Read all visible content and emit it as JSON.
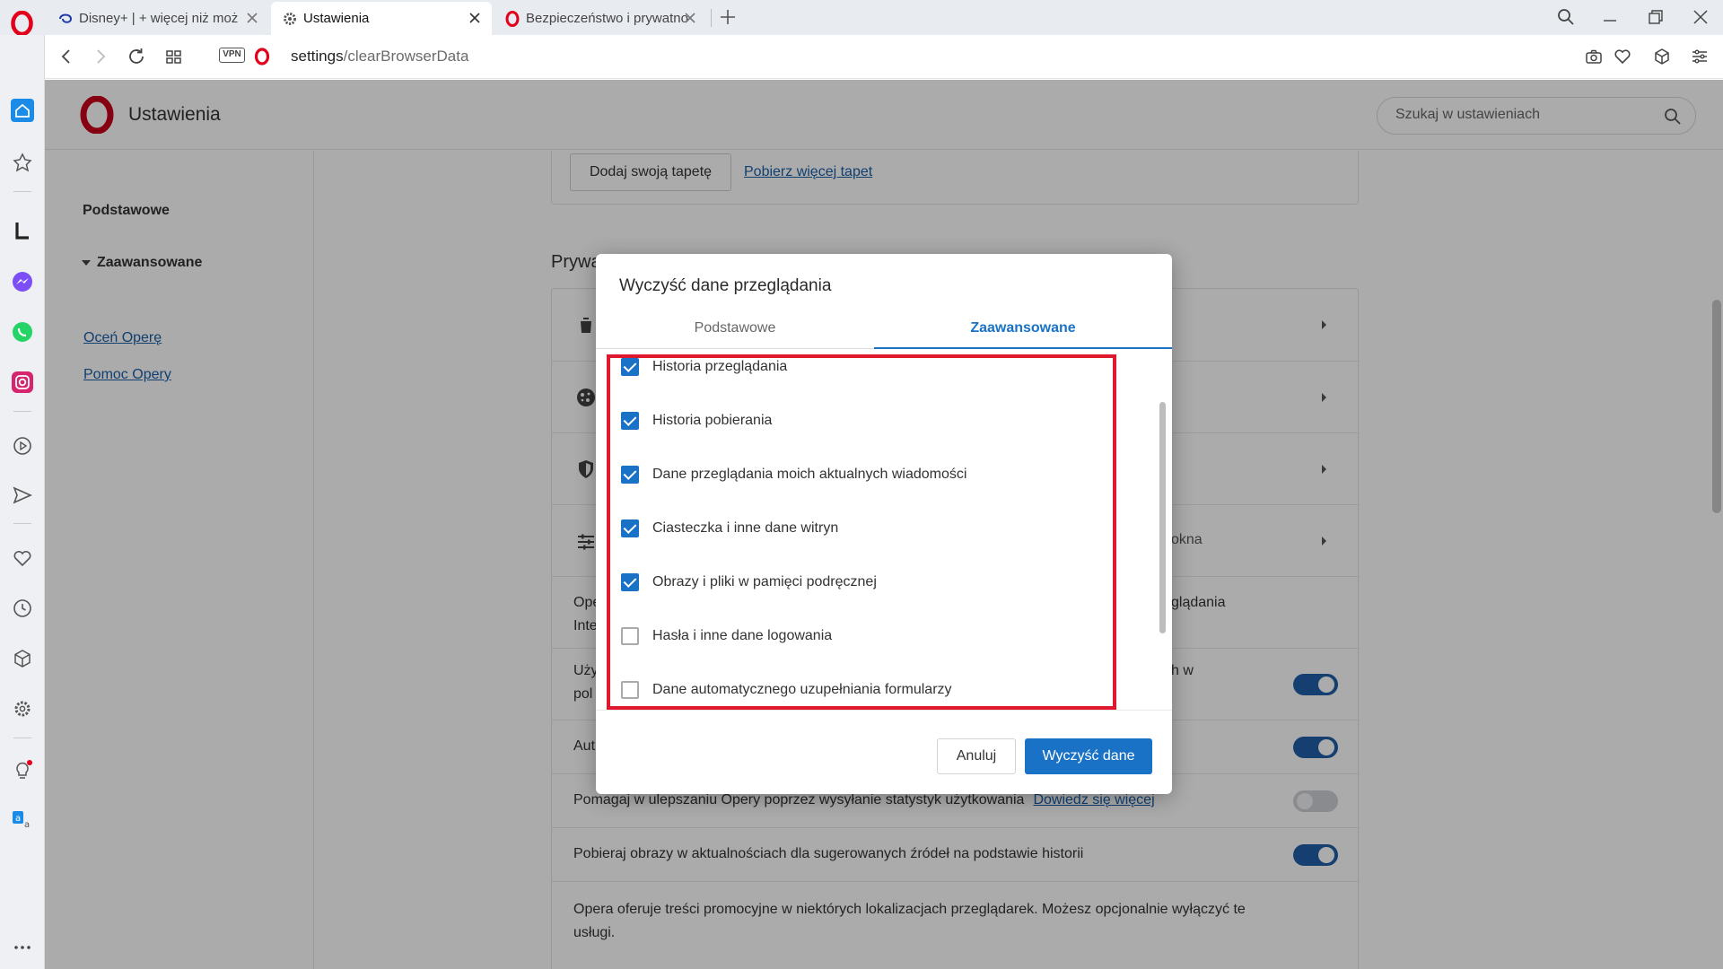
{
  "browser": {
    "tabs": [
      {
        "title": "Disney+ | + więcej niż moż",
        "active": false
      },
      {
        "title": "Ustawienia",
        "active": true
      },
      {
        "title": "Bezpieczeństwo i prywatno",
        "active": false
      }
    ],
    "vpn_label": "VPN",
    "url": {
      "host": "settings",
      "path": "/clearBrowserData"
    }
  },
  "settings": {
    "title": "Ustawienia",
    "search_placeholder": "Szukaj w ustawieniach",
    "nav": {
      "basic": "Podstawowe",
      "advanced": "Zaawansowane",
      "links": [
        "Oceń Operę",
        "Pomoc Opery"
      ]
    },
    "wallpaper": {
      "add_button": "Dodaj swoją tapetę",
      "more_link": "Pobierz więcej tapet"
    },
    "section_title": "Prywa",
    "rows": [
      {
        "text": "okna"
      },
      {
        "text_left": "Ope",
        "text_left2": "Inte",
        "text_right": "glądania"
      },
      {
        "text_left": "Uży",
        "text_left2": "pol",
        "text_right": "h w",
        "toggle": "on"
      },
      {
        "text_left": "Aut",
        "toggle": "on"
      },
      {
        "text": "Pomagaj w ulepszaniu Opery poprzez wysyłanie statystyk użytkowania",
        "link": "Dowiedz się więcej",
        "toggle": "off"
      },
      {
        "text": "Pobieraj obrazy w aktualnościach dla sugerowanych źródeł na podstawie historii",
        "toggle": "on"
      },
      {
        "text": "Opera oferuje treści promocyjne w niektórych lokalizacjach przeglądarek. Możesz opcjonalnie wyłączyć te",
        "text2": "usługi."
      }
    ]
  },
  "dialog": {
    "title": "Wyczyść dane przeglądania",
    "tabs": [
      "Podstawowe",
      "Zaawansowane"
    ],
    "active_tab": "Zaawansowane",
    "options": [
      {
        "label": "Historia przeglądania",
        "checked": true
      },
      {
        "label": "Historia pobierania",
        "checked": true
      },
      {
        "label": "Dane przeglądania moich aktualnych wiadomości",
        "checked": true
      },
      {
        "label": "Ciasteczka i inne dane witryn",
        "checked": true
      },
      {
        "label": "Obrazy i pliki w pamięci podręcznej",
        "checked": true
      },
      {
        "label": "Hasła i inne dane logowania",
        "checked": false
      },
      {
        "label": "Dane automatycznego uzupełniania formularzy",
        "checked": false
      }
    ],
    "cancel_label": "Anuluj",
    "confirm_label": "Wyczyść dane",
    "highlight_color": "#e0182d",
    "accent_color": "#1a72c6"
  }
}
